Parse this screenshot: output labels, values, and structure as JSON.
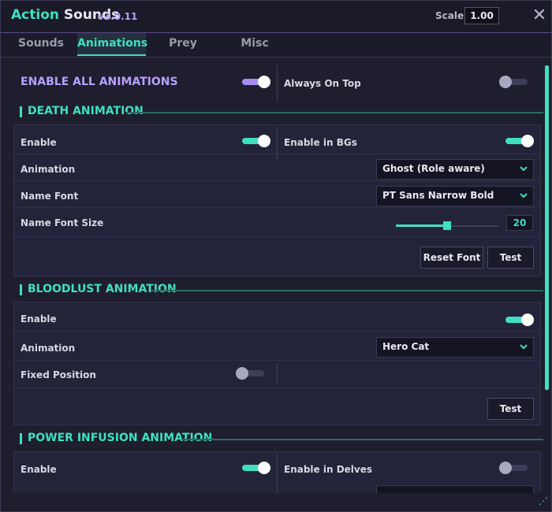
{
  "window": {
    "title_part1": "Action",
    "title_part2": "Sounds",
    "version": "v3.0.11",
    "scale_label": "Scale:",
    "scale_value": "1.00"
  },
  "tabs": [
    {
      "label": "Sounds",
      "active": false
    },
    {
      "label": "Animations",
      "active": true
    },
    {
      "label": "Prey",
      "active": false
    },
    {
      "label": "Misc",
      "active": false
    }
  ],
  "top": {
    "enable_all_label": "ENABLE ALL ANIMATIONS",
    "enable_all_on": true,
    "always_on_top_label": "Always On Top",
    "always_on_top_on": false
  },
  "death": {
    "heading": "DEATH ANIMATION",
    "enable_label": "Enable",
    "enable_on": true,
    "enable_bgs_label": "Enable in BGs",
    "enable_bgs_on": true,
    "animation_label": "Animation",
    "animation_value": "Ghost (Role aware)",
    "name_font_label": "Name Font",
    "name_font_value": "PT Sans Narrow Bold",
    "name_font_size_label": "Name Font Size",
    "name_font_size_value": "20",
    "name_font_size_fraction": 0.5,
    "reset_font_label": "Reset Font",
    "test_label": "Test"
  },
  "bloodlust": {
    "heading": "BLOODLUST ANIMATION",
    "enable_label": "Enable",
    "enable_on": true,
    "animation_label": "Animation",
    "animation_value": "Hero Cat",
    "fixed_position_label": "Fixed Position",
    "fixed_position_on": false,
    "test_label": "Test"
  },
  "power_infusion": {
    "heading": "POWER INFUSION ANIMATION",
    "enable_label": "Enable",
    "enable_on": true,
    "enable_delves_label": "Enable in Delves",
    "enable_delves_on": false
  },
  "colors": {
    "accent": "#3ee0c0",
    "purple": "#b9a0ff",
    "background": "#1e1e2e",
    "panel": "#23233a"
  },
  "icons": {
    "close": "close-icon",
    "chevron": "chevron-down-icon",
    "resize": "resize-grip-icon"
  }
}
